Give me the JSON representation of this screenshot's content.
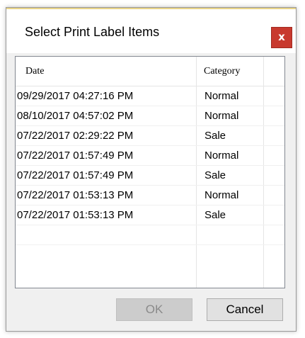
{
  "dialog": {
    "title": "Select Print Label Items",
    "close_label": "x"
  },
  "table": {
    "columns": [
      "Date",
      "Category"
    ],
    "rows": [
      {
        "date": "09/29/2017 04:27:16 PM",
        "category": "Normal"
      },
      {
        "date": "08/10/2017 04:57:02 PM",
        "category": "Normal"
      },
      {
        "date": "07/22/2017 02:29:22 PM",
        "category": "Sale"
      },
      {
        "date": "07/22/2017 01:57:49 PM",
        "category": "Normal"
      },
      {
        "date": "07/22/2017 01:57:49 PM",
        "category": "Sale"
      },
      {
        "date": "07/22/2017 01:53:13 PM",
        "category": "Normal"
      },
      {
        "date": "07/22/2017 01:53:13 PM",
        "category": "Sale"
      }
    ]
  },
  "buttons": {
    "ok_label": "OK",
    "cancel_label": "Cancel"
  },
  "colors": {
    "close_button": "#c8392e",
    "accent_line": "#e8d488"
  }
}
